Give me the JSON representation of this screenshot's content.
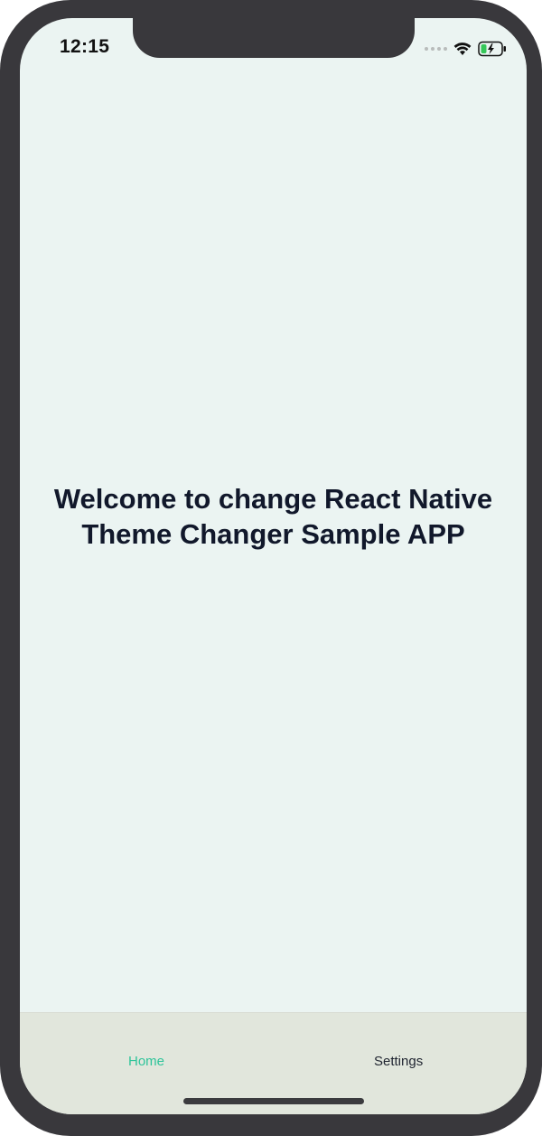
{
  "status_bar": {
    "time": "12:15",
    "icons": [
      "signal-dots-icon",
      "wifi-icon",
      "battery-charging-icon"
    ]
  },
  "main": {
    "headline": "Welcome to change React Native Theme Changer Sample APP"
  },
  "tab_bar": {
    "tabs": [
      {
        "label": "Home",
        "active": true
      },
      {
        "label": "Settings",
        "active": false
      }
    ]
  },
  "colors": {
    "screen_background": "#ebf4f2",
    "tab_bar_background": "#e1e6dc",
    "active_tab": "#2ec49a",
    "inactive_tab": "#1f2430",
    "headline_text": "#11182b",
    "device_frame": "#39383c"
  }
}
